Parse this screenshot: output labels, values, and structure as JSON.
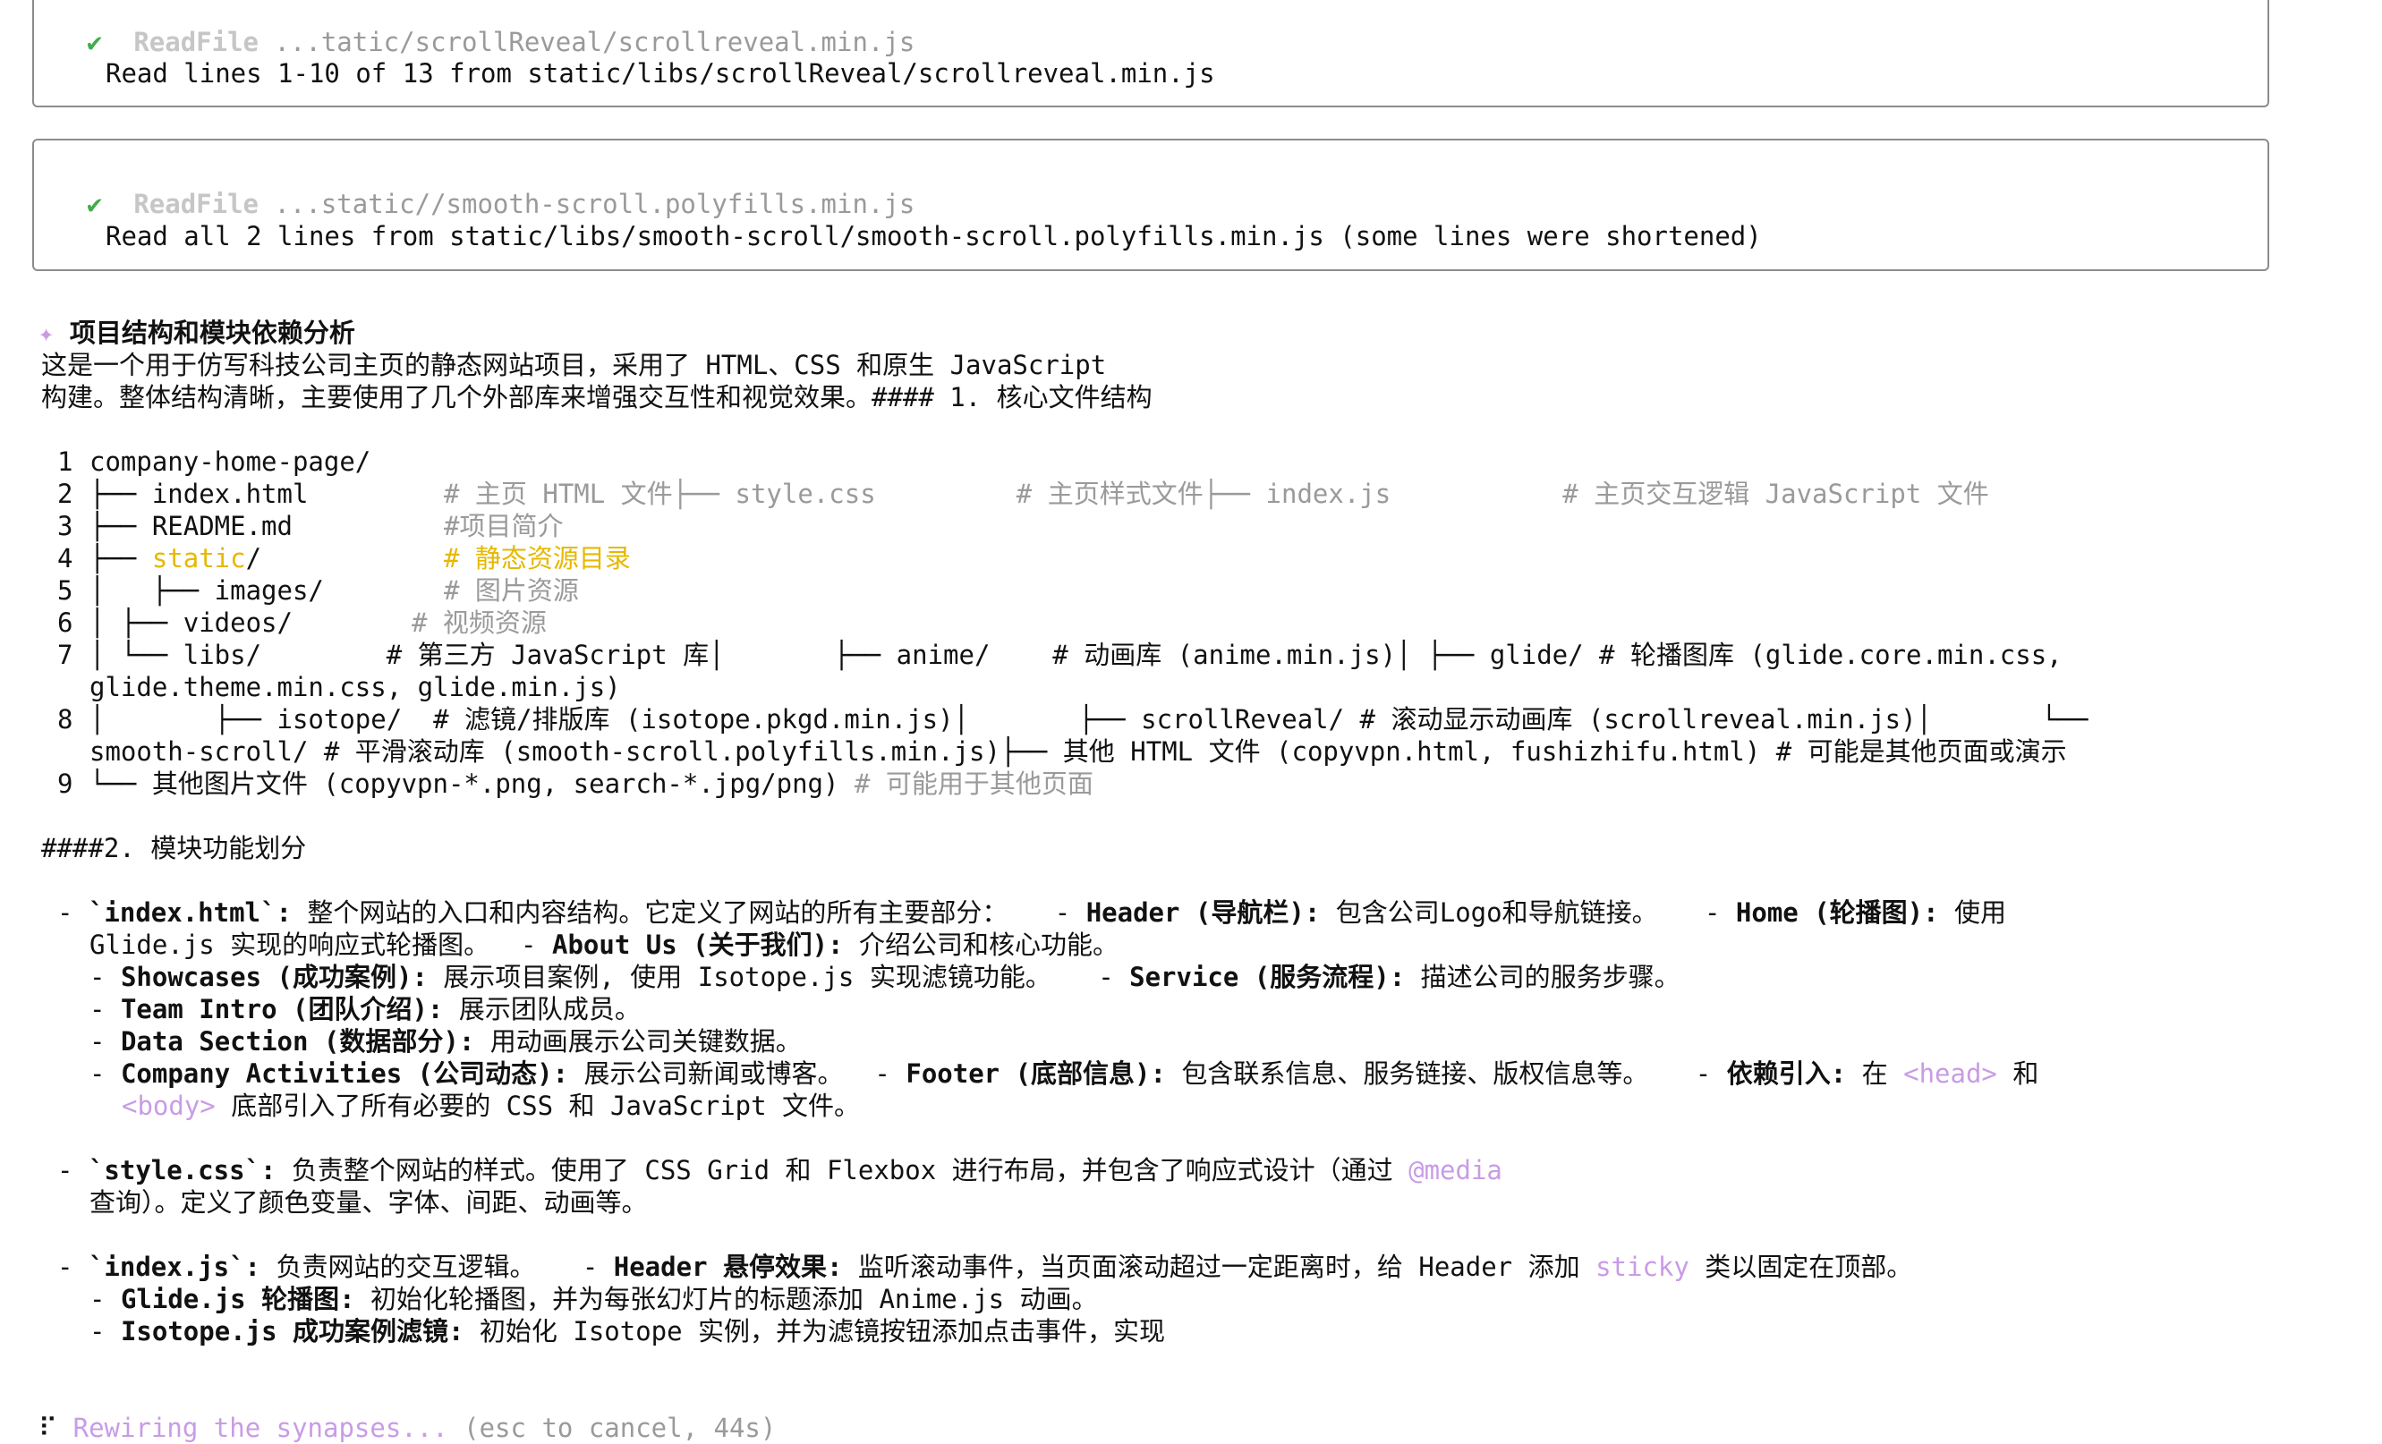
{
  "tool_calls": [
    {
      "status_glyph": "✔",
      "tool": "ReadFile",
      "path": "...tatic/scrollReveal/scrollreveal.min.js",
      "result": "Read lines 1-10 of 13 from static/libs/scrollReveal/scrollreveal.min.js"
    },
    {
      "status_glyph": "✔",
      "tool": "ReadFile",
      "path": "...static//smooth-scroll.polyfills.min.js",
      "result": "Read all 2 lines from static/libs/smooth-scroll/smooth-scroll.polyfills.min.js (some lines were shortened)"
    }
  ],
  "response": {
    "marker": "✦",
    "heading": "项目结构和模块依赖分析",
    "intro_1": "这是一个用于仿写科技公司主页的静态网站项目，采用了 HTML、CSS 和原生 JavaScript",
    "intro_2": "构建。整体结构清晰，主要使用了几个外部库来增强交互性和视觉效果。#### 1. 核心文件结构",
    "code": {
      "n1": "1",
      "l1": "company-home-page/",
      "n2": "2",
      "l2a": "├── index.html",
      "l2b": "# 主页 HTML 文件├── style.css         # 主页样式文件├── index.js           # 主页交互逻辑 JavaScript 文件",
      "n3": "3",
      "l3a": "├── README.md",
      "l3b": "#项目简介",
      "n4": "4",
      "l4a": "├── ",
      "l4b": "static",
      "l4c": "/",
      "l4d": "# 静态资源目录",
      "n5": "5",
      "l5a": "│   ├── images/",
      "l5b": "# 图片资源",
      "n6": "6",
      "l6a": "│ ├── videos/",
      "l6b": "# 视频资源",
      "n7": "7",
      "l7a": "│ └── libs/        # 第三方 JavaScript 库│       ├── anime/    # 动画库 (anime.min.js)│ ├── glide/ # 轮播图库 (glide.core.min.css,",
      "l7b": "glide.theme.min.css, glide.min.js)",
      "n8": "8",
      "l8a": "│       ├── isotope/  # 滤镜/排版库 (isotope.pkgd.min.js)│       ├── scrollReveal/ # 滚动显示动画库 (scrollreveal.min.js)│       └──",
      "l8b": "smooth-scroll/ # 平滑滚动库 (smooth-scroll.polyfills.min.js)├── 其他 HTML 文件 (copyvpn.html, fushizhifu.html) # 可能是其他页面或演示",
      "n9": "9",
      "l9a": "└── 其他图片文件 (copyvpn-*.png, search-*.jpg/png)",
      "l9b": " # 可能用于其他页面"
    },
    "sec2_heading": "####2. 模块功能划分",
    "b1": {
      "dash": "-",
      "code": "`index.html`:",
      "t1": " 整个网站的入口和内容结构。它定义了网站的所有主要部分：   - ",
      "h_header": "Header (导航栏):",
      "t2": " 包含公司Logo和导航链接。   - ",
      "h_home": "Home (轮播图):",
      "t3": " 使用",
      "t4": "Glide.js 实现的响应式轮播图。  - ",
      "h_about": "About Us (关于我们):",
      "t5": " 介绍公司和核心功能。",
      "h_show": "Showcases (成功案例):",
      "t6": " 展示项目案例, 使用 Isotope.js 实现滤镜功能。   - ",
      "h_service": "Service (服务流程):",
      "t7": " 描述公司的服务步骤。",
      "h_team": "Team Intro (团队介绍):",
      "t8": " 展示团队成员。",
      "h_data": "Data Section (数据部分):",
      "t9": " 用动画展示公司关键数据。",
      "h_comp": "Company Activities (公司动态):",
      "t10": " 展示公司新闻或博客。  - ",
      "h_footer": "Footer (底部信息):",
      "t11": " 包含联系信息、服务链接、版权信息等。   - ",
      "h_deps": "依赖引入:",
      "t12": " 在 ",
      "tag_head": "<head>",
      "t13": " 和",
      "tag_body": "<body>",
      "t14": " 底部引入了所有必要的 CSS 和 JavaScript 文件。",
      "sub_dash": "-"
    },
    "b2": {
      "dash": "-",
      "code": "`style.css`:",
      "t1": " 负责整个网站的样式。使用了 CSS Grid 和 Flexbox 进行布局，并包含了响应式设计（通过 ",
      "media": "@media",
      "t2": "查询）。定义了颜色变量、字体、间距、动画等。"
    },
    "b3": {
      "dash": "-",
      "code": "`index.js`:",
      "t1": " 负责网站的交互逻辑。   - ",
      "h_sticky": "Header 悬停效果:",
      "t2": " 监听滚动事件，当页面滚动超过一定距离时，给 Header 添加 ",
      "sticky": "sticky",
      "t3": " 类以固定在顶部。",
      "h_glide": "Glide.js 轮播图:",
      "t4": " 初始化轮播图，并为每张幻灯片的标题添加 Anime.js 动画。",
      "h_iso": "Isotope.js 成功案例滤镜:",
      "t5": " 初始化 Isotope 实例，并为滤镜按钮添加点击事件，实现",
      "sub_dash": "-"
    }
  },
  "status_bar": {
    "spinner": "⠏",
    "message": "Rewiring the synapses...",
    "hint": "(esc to cancel, 44s)"
  },
  "colors": {
    "status_ok": "#3fae4a",
    "accent_purple": "#c89ce6",
    "folder_gold": "#e6b800",
    "comment_gray": "#9a9a9a"
  }
}
